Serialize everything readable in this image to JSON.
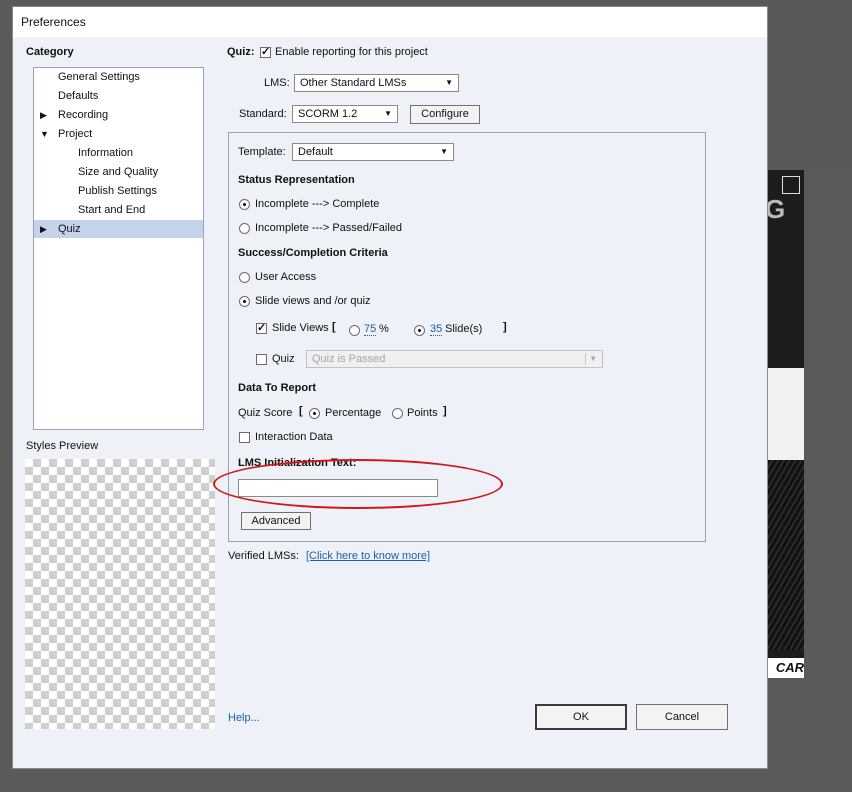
{
  "dialog": {
    "title": "Preferences"
  },
  "category": {
    "header": "Category",
    "items": [
      {
        "label": "General Settings",
        "expander": ""
      },
      {
        "label": "Defaults",
        "expander": ""
      },
      {
        "label": "Recording",
        "expander": "▶"
      },
      {
        "label": "Project",
        "expander": "▼"
      },
      {
        "label": "Information",
        "expander": ""
      },
      {
        "label": "Size and Quality",
        "expander": ""
      },
      {
        "label": "Publish Settings",
        "expander": ""
      },
      {
        "label": "Start and End",
        "expander": ""
      },
      {
        "label": "Quiz",
        "expander": "▶",
        "selected": true
      }
    ]
  },
  "styles_preview": {
    "label": "Styles Preview"
  },
  "quiz": {
    "label": "Quiz:",
    "enable_reporting": {
      "label": "Enable reporting for this project",
      "checked": true
    },
    "lms": {
      "label": "LMS:",
      "value": "Other Standard LMSs"
    },
    "standard": {
      "label": "Standard:",
      "value": "SCORM 1.2"
    },
    "configure_label": "Configure",
    "template": {
      "label": "Template:",
      "value": "Default"
    },
    "status_representation": {
      "heading": "Status Representation",
      "options": [
        "Incomplete ---> Complete",
        "Incomplete ---> Passed/Failed"
      ],
      "selected": 0
    },
    "success_criteria": {
      "heading": "Success/Completion Criteria",
      "user_access": "User Access",
      "slide_views_and_quiz": "Slide views and /or quiz",
      "selected": "slide_views_and_quiz",
      "slide_views": {
        "label": "Slide Views",
        "checked": true,
        "open_bracket": "[",
        "close_bracket": "]",
        "percent_value": "75",
        "percent_unit": "%",
        "slides_value": "35",
        "slides_unit": "Slide(s)",
        "selected": "slides"
      },
      "quiz_option": {
        "label": "Quiz",
        "checked": false,
        "value": "Quiz is Passed"
      }
    },
    "data_to_report": {
      "heading": "Data To Report",
      "quiz_score_label": "Quiz Score",
      "open_bracket": "[",
      "close_bracket": "]",
      "percentage": "Percentage",
      "points": "Points",
      "selected": "percentage",
      "interaction_data": {
        "label": "Interaction Data",
        "checked": false
      }
    },
    "lms_init": {
      "label": "LMS Initialization Text:",
      "value": ""
    },
    "advanced_label": "Advanced",
    "verified_lms": {
      "label": "Verified LMSs:",
      "link": "[Click here to know more]"
    }
  },
  "footer": {
    "help": "Help...",
    "ok": "OK",
    "cancel": "Cancel"
  },
  "background": {
    "logo_text": "CAR",
    "letter": "G"
  },
  "colors": {
    "annotation": "#d01818",
    "link": "#1f5ea8",
    "selection": "#c4d3ea"
  }
}
